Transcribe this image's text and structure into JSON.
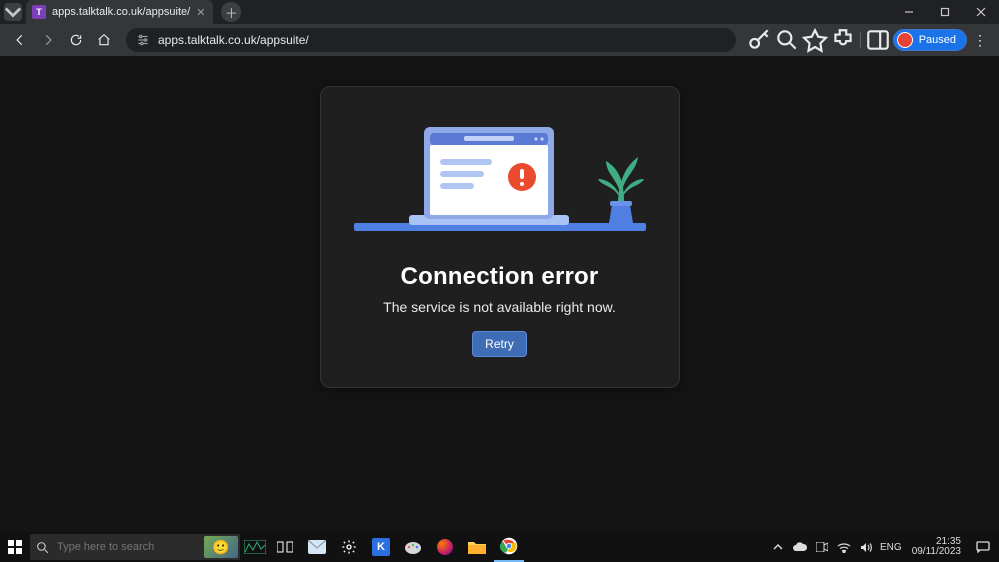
{
  "browser": {
    "tab": {
      "favicon_letter": "T",
      "title": "apps.talktalk.co.uk/appsuite/"
    },
    "url": "apps.talktalk.co.uk/appsuite/",
    "profile_label": "Paused"
  },
  "page": {
    "heading": "Connection error",
    "message": "The service is not available right now.",
    "retry_label": "Retry"
  },
  "taskbar": {
    "search_placeholder": "Type here to search",
    "lang": "ENG",
    "time": "21:35",
    "date": "09/11/2023"
  }
}
